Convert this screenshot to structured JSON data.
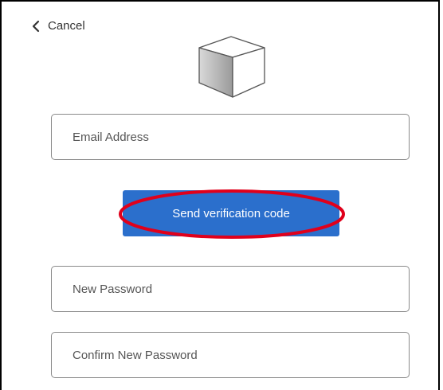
{
  "header": {
    "cancel_label": "Cancel"
  },
  "logo": {
    "icon": "cube-icon"
  },
  "form": {
    "email_placeholder": "Email Address",
    "send_code_label": "Send verification code",
    "new_password_placeholder": "New Password",
    "confirm_password_placeholder": "Confirm New Password"
  },
  "colors": {
    "primary": "#2b6fcc",
    "highlight_ring": "#e0001b",
    "border": "#8a8a8a"
  }
}
